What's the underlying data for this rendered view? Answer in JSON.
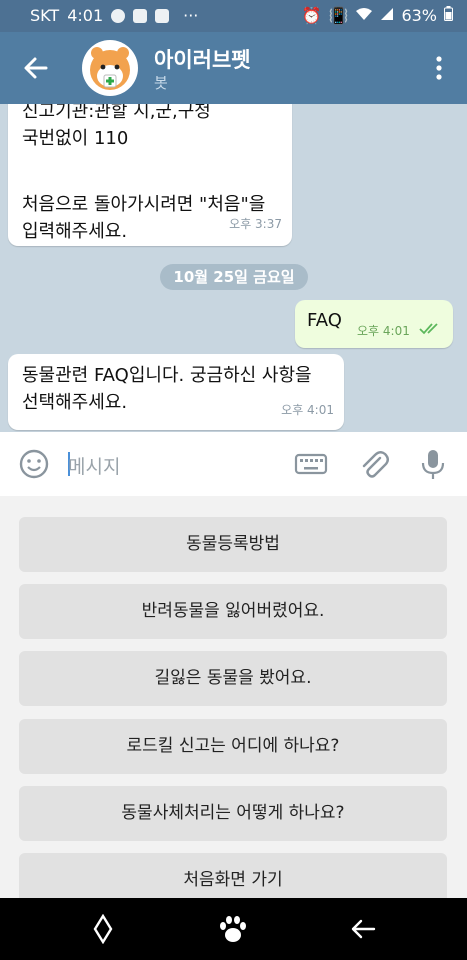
{
  "status_bar": {
    "carrier": "SKT",
    "time": "4:01",
    "battery": "63%",
    "more": "···"
  },
  "app_bar": {
    "title": "아이러브펫",
    "subtitle": "봇"
  },
  "messages": {
    "incoming_1": {
      "lines": [
        "신고기관:관할 시,군,구청",
        "국번없이 110",
        "",
        "처음으로 돌아가시려면 \"처음\"을",
        "입력해주세요."
      ],
      "time": "오후 3:37"
    },
    "date_separator": "10월 25일 금요일",
    "outgoing_1": {
      "text": "FAQ",
      "time": "오후 4:01"
    },
    "incoming_2": {
      "lines": [
        "동물관련 FAQ입니다. 궁금하신 사항을",
        "선택해주세요."
      ],
      "time": "오후 4:01"
    }
  },
  "input": {
    "placeholder": "메시지"
  },
  "bot_keyboard": {
    "buttons": [
      "동물등록방법",
      "반려동물을 잃어버렸어요.",
      "길잃은 동물을 봤어요.",
      "로드킬 신고는 어디에 하나요?",
      "동물사체처리는 어떻게 하나요?",
      "처음화면 가기"
    ]
  },
  "colors": {
    "appbar": "#517da2",
    "statusbar": "#4d7193",
    "chat_bg": "#c8d6e0",
    "outgoing_bubble": "#effdde",
    "read_check": "#5cb85c"
  }
}
